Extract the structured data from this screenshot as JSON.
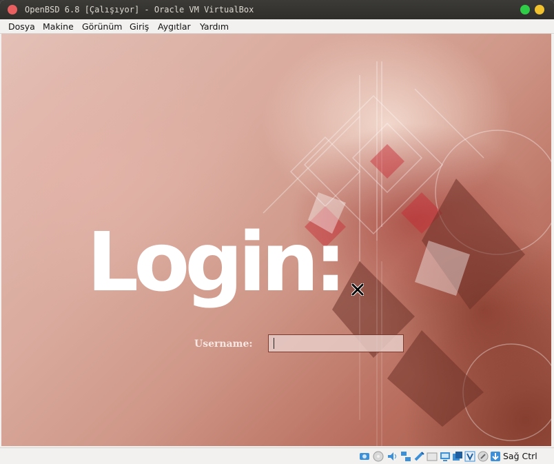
{
  "window": {
    "title": "OpenBSD 6.8 [Çalışıyor] - Oracle VM VirtualBox"
  },
  "menu": {
    "items": [
      "Dosya",
      "Makine",
      "Görünüm",
      "Giriş",
      "Aygıtlar",
      "Yardım"
    ]
  },
  "guest": {
    "login_title": "Login:",
    "username_label": "Username:",
    "username_value": ""
  },
  "statusbar": {
    "icons": [
      "hard-disk-icon",
      "optical-drive-icon",
      "audio-icon",
      "network-icon",
      "usb-icon",
      "shared-folders-icon",
      "display-icon",
      "video-capture-icon",
      "virtualization-icon",
      "mouse-integration-icon",
      "host-key-arrow-icon"
    ],
    "host_key_label": "Sağ Ctrl"
  },
  "colors": {
    "titlebar": "#2f2e2b",
    "close_button": "#e95f5f",
    "minimize_button": "#2fcc47",
    "maximize_button": "#f2c12e",
    "menubar": "#f2f1f0"
  }
}
